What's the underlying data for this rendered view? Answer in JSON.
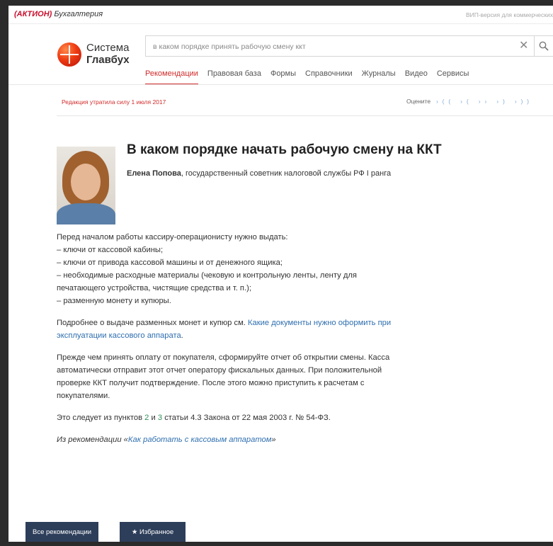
{
  "topbar": {
    "brand_main": "(АКТИОН)",
    "brand_sub": "Бухгалтерия",
    "vip": "ВИП-версия для коммерческих"
  },
  "logo": {
    "line1": "Система",
    "line2": "Главбух"
  },
  "search": {
    "value": "в каком порядке принять рабочую смену ккт"
  },
  "nav": {
    "tabs": [
      {
        "label": "Рекомендации",
        "active": true
      },
      {
        "label": "Правовая база"
      },
      {
        "label": "Формы"
      },
      {
        "label": "Справочники"
      },
      {
        "label": "Журналы"
      },
      {
        "label": "Видео"
      },
      {
        "label": "Сервисы"
      }
    ]
  },
  "notice": "Редакция утратила силу 1 июля 2017",
  "rate": {
    "label": "Оцените",
    "arrows": "›(( ›( ›› ›) ›))"
  },
  "article": {
    "title": "В каком порядке начать рабочую смену на ККТ",
    "author_name": "Елена Попова",
    "author_role": ", государственный советник налоговой службы РФ I ранга",
    "p1": [
      "Перед началом работы кассиру-операционисту нужно выдать:",
      "– ключи от кассовой кабины;",
      "– ключи от привода кассовой машины и от денежного ящика;",
      "– необходимые расходные материалы (чековую и контрольную ленты, ленту для",
      "печатающего устройства, чистящие средства и т. п.);",
      "– разменную монету и купюры."
    ],
    "p2_text": "Подробнее о выдаче разменных монет и купюр см. ",
    "p2_link1": "Какие документы нужно оформить при",
    "p2_link2": "эксплуатации кассового аппарата",
    "p2_end": ".",
    "p3": [
      "Прежде чем принять оплату от покупателя, сформируйте отчет об открытии смены. Касса",
      "автоматически отправит этот отчет оператору фискальных данных. При положительной",
      "проверке ККТ получит подтверждение. После этого можно приступить к расчетам с",
      "покупателями."
    ],
    "p4_a": "Это следует из пунктов ",
    "p4_n1": "2",
    "p4_b": " и ",
    "p4_n2": "3",
    "p4_c": " статьи 4.3 Закона от 22 мая 2003 г. № 54-ФЗ.",
    "p5_a": "Из рекомендации «",
    "p5_link": "Как работать с кассовым аппаратом",
    "p5_b": "»"
  },
  "buttons": {
    "all_recs": "Все рекомендации",
    "favorites": "Избранное",
    "favorites_icon": "★"
  },
  "colors": {
    "accent": "#d22b2b",
    "link": "#2f6fb0",
    "button_bg": "#2d3e5a"
  }
}
